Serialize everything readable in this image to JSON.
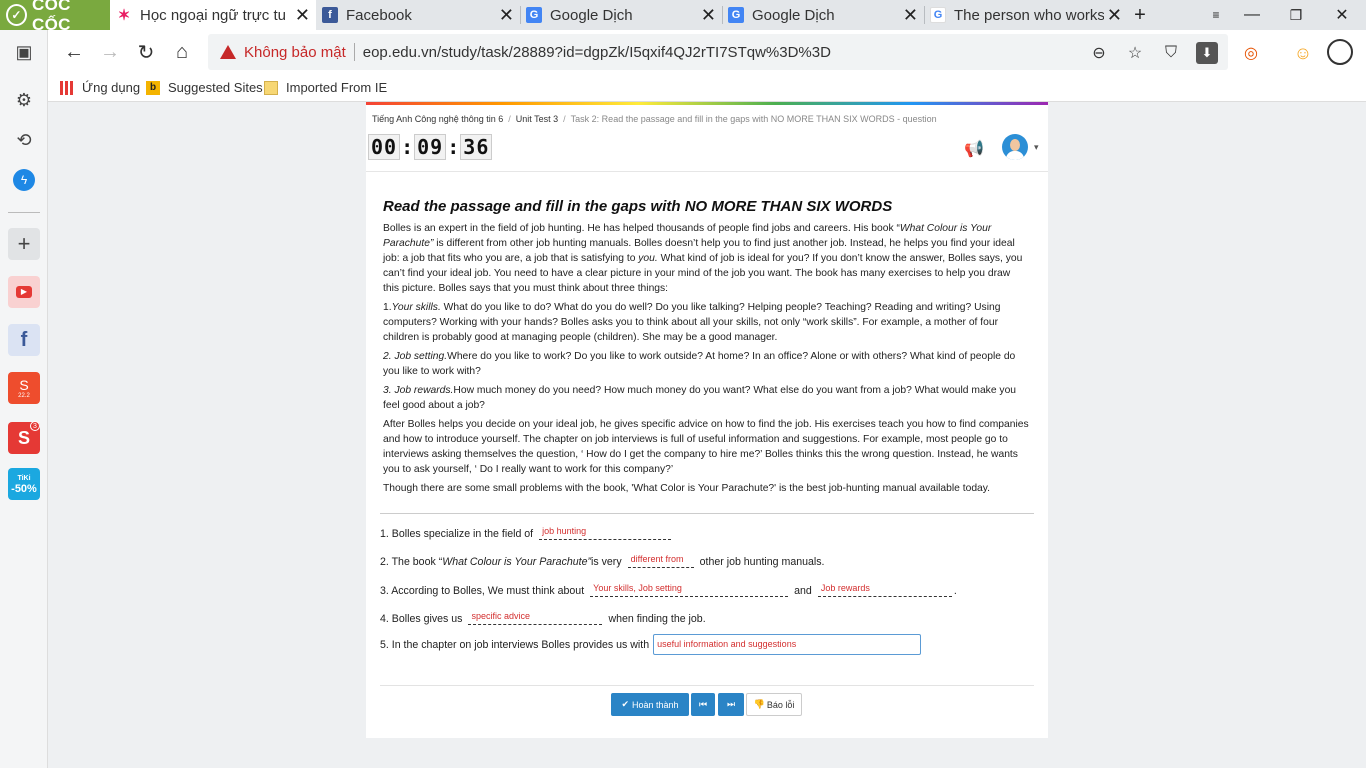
{
  "browser": {
    "brand": "CỐC CỐC",
    "tabs": [
      {
        "title": "Học ngoại ngữ trực tuyế",
        "active": true,
        "icon": "eop-icon"
      },
      {
        "title": "Facebook",
        "active": false,
        "icon": "facebook-icon"
      },
      {
        "title": "Google Dịch",
        "active": false,
        "icon": "google-translate-icon"
      },
      {
        "title": "Google Dịch",
        "active": false,
        "icon": "google-translate-icon"
      },
      {
        "title": "The person who works v",
        "active": false,
        "icon": "google-icon"
      }
    ],
    "address": {
      "security_label": "Không bảo mật",
      "url": "eop.edu.vn/study/task/28889?id=dgpZk/I5qxif4QJ2rTI7STqw%3D%3D"
    },
    "bookmarks": [
      {
        "label": "Ứng dụng",
        "icon": "apps-icon"
      },
      {
        "label": "Suggested Sites",
        "icon": "bing-icon"
      },
      {
        "label": "Imported From IE",
        "icon": "folder-icon"
      }
    ],
    "sidebar_badges": {
      "shopee": "22.2",
      "sendo": "3",
      "tiki_logo": "TiKi",
      "tiki": "-50%"
    }
  },
  "page": {
    "breadcrumb": [
      "Tiếng Anh Công nghệ thông tin 6",
      "Unit Test 3",
      "Task 2: Read the passage and fill in the gaps with NO MORE THAN SIX WORDS - question"
    ],
    "timer": {
      "h": "00",
      "m": "09",
      "s": "36"
    },
    "title": "Read the passage and fill in the gaps with NO MORE THAN SIX WORDS",
    "passage": {
      "p1_a": "Bolles is an expert in the field of job hunting. He has helped thousands of people find jobs and careers. His book “",
      "p1_i1": "What Colour is Your Parachute”",
      "p1_b": " is different from other job hunting manuals. Bolles doesn’t help you to find just another job. Instead, he helps you find your ideal job: a job that fits who you are, a job that is satisfying to ",
      "p1_i2": "you.",
      "p1_c": " What kind of job is ideal for you? If you don’t know the answer, Bolles says, you can’t find your ideal job. You need to have a clear picture in your mind of the job you want. The book has many exercises to help you draw this picture. Bolles says that you must think about three things:",
      "p2_num": "1.",
      "p2_i": "Your skills.",
      "p2_t": " What do you like to do? What do you do well? Do you like talking? Helping people? Teaching? Reading and writing? Using computers? Working with your hands? Bolles asks you to think about all your skills, not only “work skills”. For example, a mother of four children is probably good at managing people (children). She may be a good manager.",
      "p3_i": "2. Job setting.",
      "p3_t": "Where do you like to work? Do you like to work outside? At home? In an office? Alone or with others? What kind of people do you like to work with?",
      "p4_i": "3. Job rewards.",
      "p4_t": "How much money do you need? How much money do you want? What else do you want from a job? What would make you feel good about a job?",
      "p5": "After Bolles helps you decide on your ideal job, he gives specific advice on how to find the job. His exercises teach you how to find companies and how to introduce yourself. The chapter on job interviews is full of useful information and suggestions. For example, most people go to interviews asking themselves the question, ‘ How do I get the company to hire me?’ Bolles thinks this the wrong question. Instead, he wants you to ask yourself, ‘ Do I really want to work for this company?’",
      "p6": "Though there are some small problems with the book, 'What Color is Your Parachute?' is the best job-hunting manual available today."
    },
    "questions": {
      "q1_pre": "1. Bolles specialize in the field of",
      "q1_ans": "job hunting",
      "q2_pre": "2. The book “",
      "q2_i": "What Colour is Your Parachute”",
      "q2_mid": "is very",
      "q2_ans": "different from",
      "q2_post": "other job hunting manuals.",
      "q3_pre": "3. According to Bolles, We must think about",
      "q3_ans1": "Your skills, Job setting",
      "q3_and": "and",
      "q3_ans2": "Job rewards",
      "q3_post": ".",
      "q4_pre": "4. Bolles gives us",
      "q4_ans": "specific advice",
      "q4_post": "when finding the job.",
      "q5_pre": "5. In the chapter on job interviews Bolles provides us with",
      "q5_ans": "useful information and suggestions"
    },
    "buttons": {
      "finish": "Hoàn thành",
      "report": "Báo lỗi"
    }
  }
}
